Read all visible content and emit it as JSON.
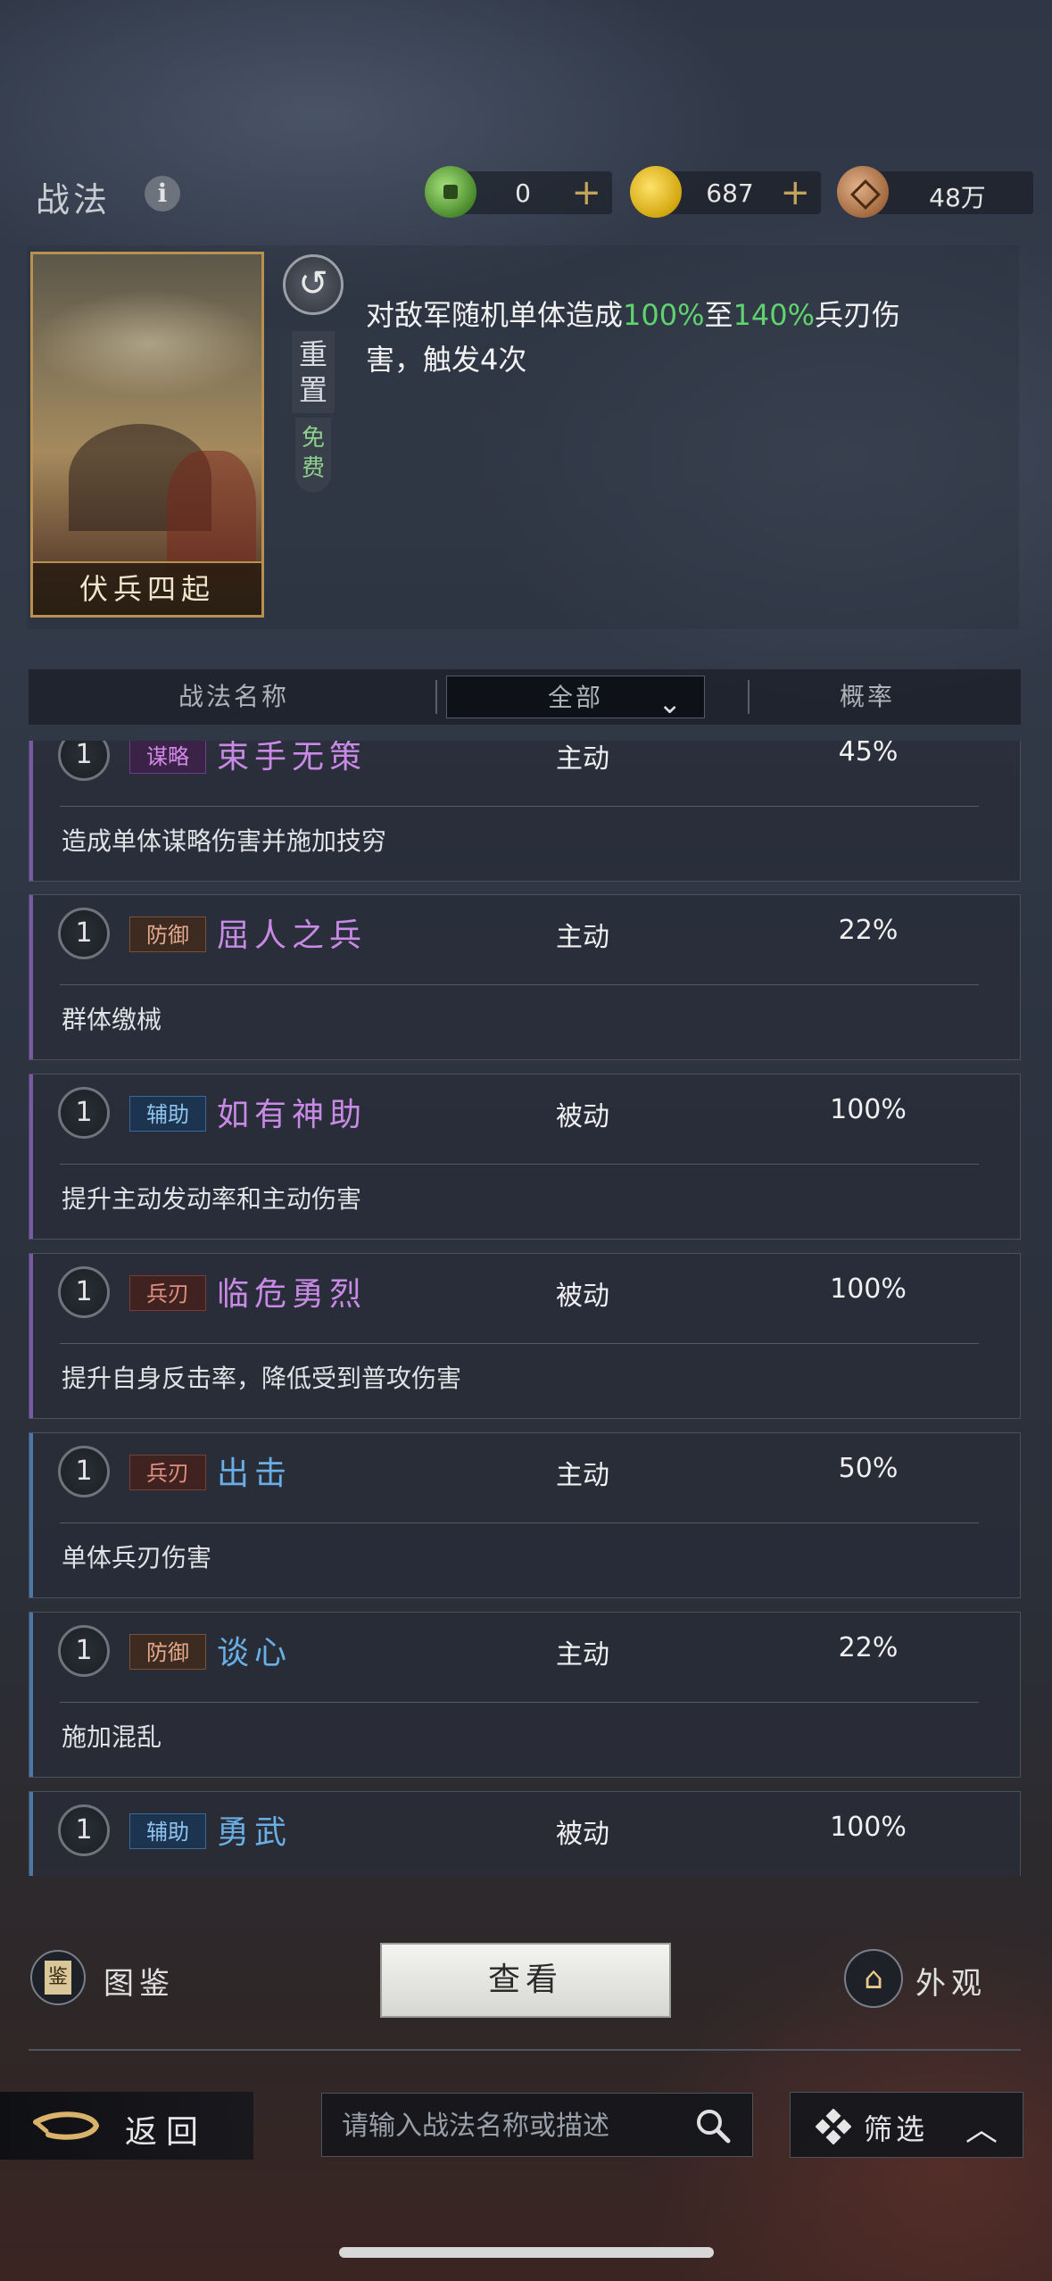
{
  "header": {
    "title": "战法",
    "currencies": [
      {
        "icon": "jade-coin-icon",
        "value": "0"
      },
      {
        "icon": "gold-coin-icon",
        "value": "687"
      },
      {
        "icon": "copper-coin-icon",
        "value": "48万"
      }
    ],
    "plus_symbol": "+"
  },
  "card": {
    "name": "伏兵四起",
    "reset_label": "重置",
    "free_label": "免费",
    "desc_prefix": "对敌军随机单体造成",
    "desc_low": "100%",
    "desc_mid": "至",
    "desc_high": "140%",
    "desc_suffix": "兵刃伤害，触发4次"
  },
  "table": {
    "col_name": "战法名称",
    "filter_value": "全部",
    "col_rate": "概率"
  },
  "skills": [
    {
      "level": "1",
      "tag": "谋略",
      "name": "束手无策",
      "type": "主动",
      "rate": "45%",
      "desc": "造成单体谋略伤害并施加技穷"
    },
    {
      "level": "1",
      "tag": "防御",
      "name": "屈人之兵",
      "type": "主动",
      "rate": "22%",
      "desc": "群体缴械"
    },
    {
      "level": "1",
      "tag": "辅助",
      "name": "如有神助",
      "type": "被动",
      "rate": "100%",
      "desc": "提升主动发动率和主动伤害"
    },
    {
      "level": "1",
      "tag": "兵刃",
      "name": "临危勇烈",
      "type": "被动",
      "rate": "100%",
      "desc": "提升自身反击率，降低受到普攻伤害"
    },
    {
      "level": "1",
      "tag": "兵刃",
      "name": "出击",
      "type": "主动",
      "rate": "50%",
      "desc": "单体兵刃伤害"
    },
    {
      "level": "1",
      "tag": "防御",
      "name": "谈心",
      "type": "主动",
      "rate": "22%",
      "desc": "施加混乱"
    },
    {
      "level": "1",
      "tag": "辅助",
      "name": "勇武",
      "type": "被动",
      "rate": "100%",
      "desc": ""
    }
  ],
  "bottom": {
    "tujian_label": "图鉴",
    "view_label": "查看",
    "waiguan_label": "外观",
    "back_label": "返回",
    "search_placeholder": "请输入战法名称或描述",
    "filter_label": "筛选"
  },
  "colors": {
    "highlight_green": "#5fd46e",
    "purple_name": "#c98ae6",
    "blue_name": "#6aaee6"
  }
}
